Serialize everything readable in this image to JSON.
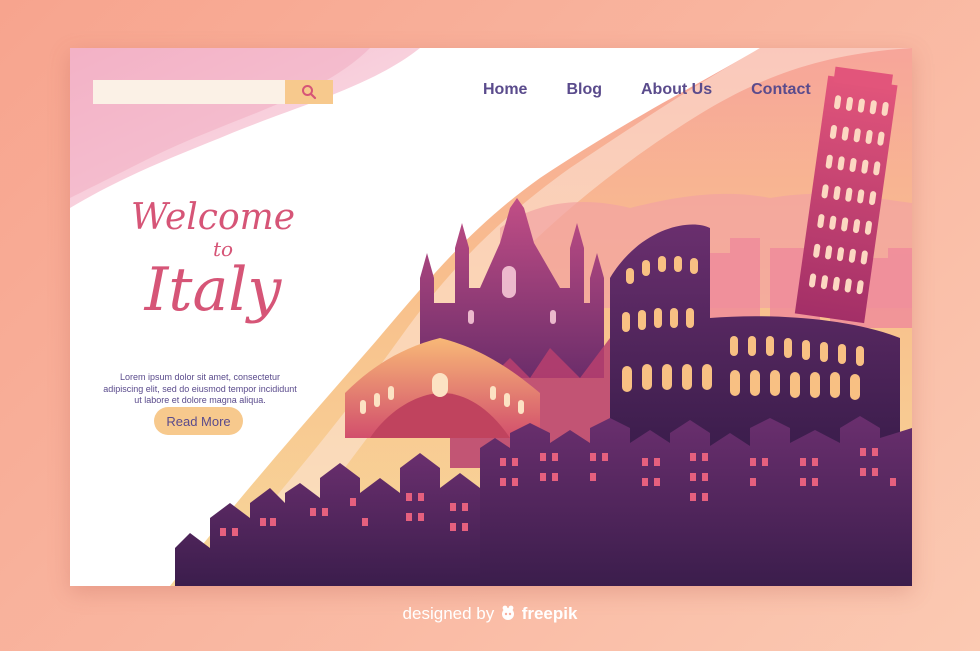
{
  "search": {
    "placeholder": "",
    "icon": "search-icon"
  },
  "nav": {
    "items": [
      "Home",
      "Blog",
      "About Us",
      "Contact"
    ]
  },
  "hero": {
    "line1": "Welcome",
    "line2": "to",
    "line3": "Italy",
    "body": "Lorem ipsum dolor sit amet, consectetur adipiscing elit, sed do eiusmod tempor incididunt ut labore et dolore magna aliqua.",
    "cta": "Read More"
  },
  "footer": {
    "prefix": "designed by",
    "brand": "freepik"
  },
  "watermark": "freepik",
  "colors": {
    "accent": "#d65577",
    "nav": "#5a4b8c",
    "button": "#f7c98d",
    "skyline_dark": "#4a2458",
    "skyline_mid": "#8c3a7a",
    "sky_warm": "#f6b77e",
    "page_bg": "#f7a48e"
  }
}
